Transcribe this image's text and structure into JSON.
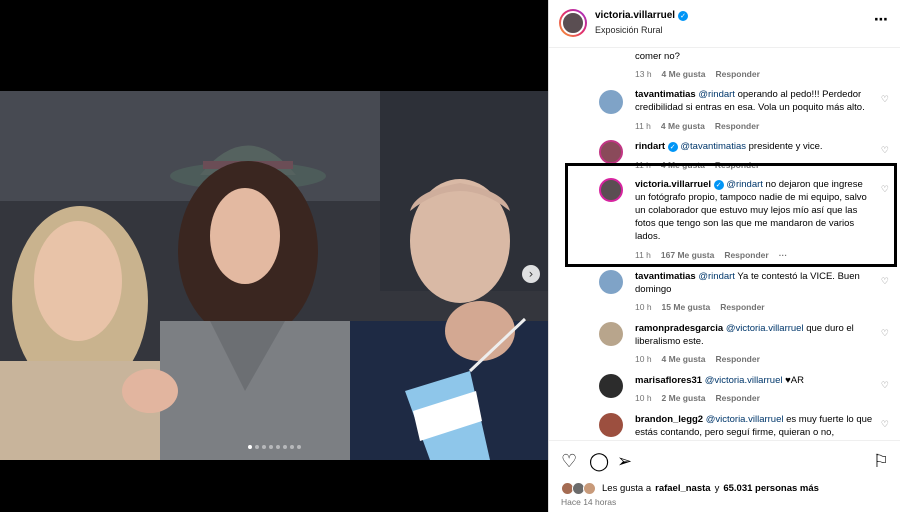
{
  "header": {
    "username": "victoria.villarruel",
    "location": "Exposición Rural",
    "more_icon": "⋯"
  },
  "comments": [
    {
      "user": "",
      "text": "comer no?",
      "time": "13 h",
      "likes": "4 Me gusta",
      "reply": "Responder",
      "avatar_color": "#c9b8a6"
    },
    {
      "user": "tavantimatias",
      "mention": "@rindart",
      "text": "operando al pedo!!! Perdedor credibilidad si entras en esa. Vola un poquito más alto.",
      "time": "11 h",
      "likes": "4 Me gusta",
      "reply": "Responder",
      "avatar_color": "#7fa3c7"
    },
    {
      "user": "rindart",
      "mention": "@tavantimatias",
      "text": "presidente y vice.",
      "time": "11 h",
      "likes": "4 Me gusta",
      "reply": "Responder",
      "avatar_color": "#8a4a5a"
    },
    {
      "user": "victoria.villarruel",
      "mention": "@rindart",
      "text": "no dejaron que ingrese un fotógrafo propio, tampoco nadie de mi equipo, salvo un colaborador que estuvo muy lejos mío así que las fotos que tengo son las que me mandaron de varios lados.",
      "time": "11 h",
      "likes": "167 Me gusta",
      "reply": "Responder",
      "more": "···",
      "avatar_color": "#5a4e52"
    },
    {
      "user": "tavantimatias",
      "mention": "@rindart",
      "text": "Ya te contestó la VICE. Buen domingo",
      "time": "10 h",
      "likes": "15 Me gusta",
      "reply": "Responder",
      "avatar_color": "#7fa3c7"
    },
    {
      "user": "ramonpradesgarcia",
      "mention": "@victoria.villarruel",
      "text": "que duro el liberalismo este.",
      "time": "10 h",
      "likes": "4 Me gusta",
      "reply": "Responder",
      "avatar_color": "#b8a58c"
    },
    {
      "user": "marisaflores31",
      "mention": "@victoria.villarruel",
      "text": "♥AR",
      "time": "10 h",
      "likes": "2 Me gusta",
      "reply": "Responder",
      "avatar_color": "#2c2c2c"
    },
    {
      "user": "brandon_legg2",
      "mention": "@victoria.villarruel",
      "text": "es muy fuerte lo que estás contando, pero seguí firme, quieran o no,",
      "time": "",
      "likes": "",
      "reply": "",
      "avatar_color": "#9c4f3f"
    }
  ],
  "likes_text_prefix": "Les gusta a",
  "likes_user": "rafael_nasta",
  "likes_text_mid": "y",
  "likes_count": "65.031 personas más",
  "post_time": "Hace 14 horas",
  "colors": {
    "accent": "#0095f6",
    "mention": "#00376b",
    "muted": "#737373"
  },
  "icons": {
    "heart": "heart-icon",
    "comment": "comment-icon",
    "share": "share-icon",
    "save": "bookmark-icon",
    "next": "chevron-right-icon"
  },
  "carousel": {
    "total": 8,
    "active": 0
  }
}
